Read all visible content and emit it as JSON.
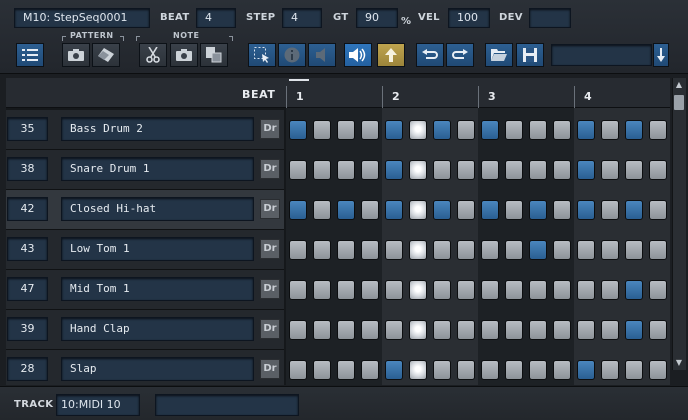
{
  "toolbar": {
    "sequence_name": "M10: StepSeq0001",
    "beat_label": "BEAT",
    "beat_value": "4",
    "step_label": "STEP",
    "step_value": "4",
    "gt_label": "GT",
    "gt_value": "90",
    "gt_unit": "%",
    "vel_label": "VEL",
    "vel_value": "100",
    "dev_label": "DEV",
    "dev_value": "",
    "pattern_group": "PATTERN",
    "note_group": "NOTE",
    "buttons": [
      "list-icon",
      "camera-icon",
      "eraser-icon",
      "scissors-icon",
      "camera-icon",
      "paste-icon",
      "select-icon",
      "info-icon",
      "speaker-icon",
      "speaker-active-icon",
      "arrow-up-icon",
      "undo-icon",
      "redo-icon",
      "folder-open-icon",
      "save-icon",
      "dropdown-arrow-icon"
    ],
    "preset_value": ""
  },
  "grid": {
    "beat_header": "BEAT",
    "beat_numbers": [
      "1",
      "2",
      "3",
      "4"
    ],
    "drum_label": "Dr",
    "current_step": 6,
    "rows": [
      {
        "note": "35",
        "name": "Bass Drum 2",
        "steps": [
          1,
          0,
          0,
          0,
          1,
          0,
          1,
          0,
          1,
          0,
          0,
          0,
          1,
          0,
          1,
          0
        ],
        "highlighted": false
      },
      {
        "note": "38",
        "name": "Snare Drum 1",
        "steps": [
          0,
          0,
          0,
          0,
          1,
          0,
          0,
          0,
          0,
          0,
          0,
          0,
          1,
          0,
          0,
          0
        ],
        "highlighted": false
      },
      {
        "note": "42",
        "name": "Closed Hi-hat",
        "steps": [
          1,
          0,
          1,
          0,
          1,
          0,
          1,
          0,
          1,
          0,
          1,
          0,
          1,
          0,
          1,
          0
        ],
        "highlighted": true
      },
      {
        "note": "43",
        "name": "Low Tom 1",
        "steps": [
          0,
          0,
          0,
          0,
          0,
          0,
          0,
          0,
          0,
          0,
          1,
          0,
          0,
          0,
          0,
          0
        ],
        "highlighted": false
      },
      {
        "note": "47",
        "name": "Mid Tom 1",
        "steps": [
          0,
          0,
          0,
          0,
          0,
          0,
          0,
          0,
          0,
          0,
          0,
          0,
          0,
          0,
          1,
          0
        ],
        "highlighted": false
      },
      {
        "note": "39",
        "name": "Hand Clap",
        "steps": [
          0,
          0,
          0,
          0,
          0,
          0,
          0,
          0,
          0,
          0,
          0,
          0,
          0,
          0,
          1,
          0
        ],
        "highlighted": false
      },
      {
        "note": "28",
        "name": "Slap",
        "steps": [
          0,
          0,
          0,
          0,
          1,
          0,
          0,
          0,
          0,
          0,
          0,
          0,
          1,
          0,
          0,
          0
        ],
        "highlighted": false
      }
    ]
  },
  "bottom": {
    "track_label": "TRACK",
    "track_value": "10:MIDI 10",
    "extra_value": ""
  },
  "colors": {
    "step_on": "#3a76ad",
    "step_off": "#a8adb3",
    "field_bg": "#233447",
    "active_button": "#2f76bd",
    "up_button": "#bfa44e"
  }
}
